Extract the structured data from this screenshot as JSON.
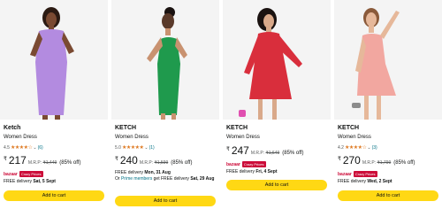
{
  "products": [
    {
      "brand": "Ketch",
      "title": "Women Dress",
      "rating": "4.5",
      "stars": "★★★★☆",
      "reviews": "(6)",
      "currency": "₹",
      "price": "217",
      "mrp_label": "M.R.P:",
      "mrp": "₹1,449",
      "discount": "(85% off)",
      "deal_brand": "bazaar",
      "deal_badge": "Crazy Prices",
      "delivery_prefix": "FREE delivery ",
      "delivery_date": "Sat, 5 Sept",
      "cart_label": "Add to cart",
      "dress_color": "#b38be0"
    },
    {
      "brand": "KETCH",
      "title": "Women Dress",
      "rating": "5.0",
      "stars": "★★★★★",
      "reviews": "(1)",
      "currency": "₹",
      "price": "240",
      "mrp_label": "M.R.P:",
      "mrp": "₹1,599",
      "discount": "(85% off)",
      "delivery_prefix": "FREE delivery ",
      "delivery_date": "Mon, 31 Aug",
      "delivery_or": "Or ",
      "prime_text": "Prime members",
      "prime_suffix": " get FREE delivery ",
      "prime_date": "Sat, 29 Aug",
      "cart_label": "Add to cart",
      "dress_color": "#1f9a4d"
    },
    {
      "brand": "KETCH",
      "title": "Women Dress",
      "currency": "₹",
      "price": "247",
      "mrp_label": "M.R.P:",
      "mrp": "₹1,649",
      "discount": "(85% off)",
      "deal_brand": "bazaar",
      "deal_badge": "Crazy Prices",
      "delivery_prefix": "FREE delivery ",
      "delivery_date": "Fri, 4 Sept",
      "cart_label": "Add to cart",
      "dress_color": "#d92e3c"
    },
    {
      "brand": "KETCH",
      "title": "Women Dress",
      "rating": "4.2",
      "stars": "★★★★☆",
      "reviews": "(3)",
      "currency": "₹",
      "price": "270",
      "mrp_label": "M.R.P:",
      "mrp": "₹1,799",
      "discount": "(85% off)",
      "deal_brand": "bazaar",
      "deal_badge": "Crazy Prices",
      "delivery_prefix": "FREE delivery ",
      "delivery_date": "Wed, 2 Sept",
      "cart_label": "Add to cart",
      "dress_color": "#f2a7a0"
    }
  ]
}
